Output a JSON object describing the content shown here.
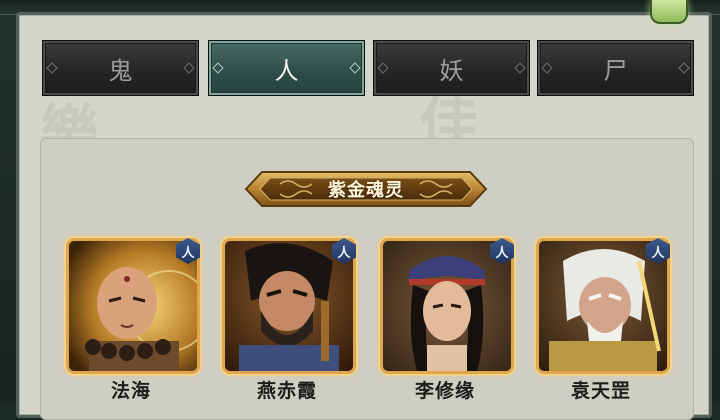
{
  "tabs": [
    {
      "label": "鬼",
      "active": false
    },
    {
      "label": "人",
      "active": true
    },
    {
      "label": "妖",
      "active": false
    },
    {
      "label": "尸",
      "active": false
    }
  ],
  "section": {
    "title": "紫金魂灵"
  },
  "characters": [
    {
      "name": "法海",
      "badge": "人",
      "icon": "monk-portrait"
    },
    {
      "name": "燕赤霞",
      "badge": "人",
      "icon": "bearded-swordsman-portrait"
    },
    {
      "name": "李修缘",
      "badge": "人",
      "icon": "young-scholar-portrait"
    },
    {
      "name": "袁天罡",
      "badge": "人",
      "icon": "white-haired-elder-portrait"
    }
  ],
  "colors": {
    "active_tab": "#2f4e48",
    "inactive_tab": "#242625",
    "card_border": "#e0a64e",
    "banner_gold": "#c99a3c",
    "panel_bg": "#d6d5cb"
  }
}
